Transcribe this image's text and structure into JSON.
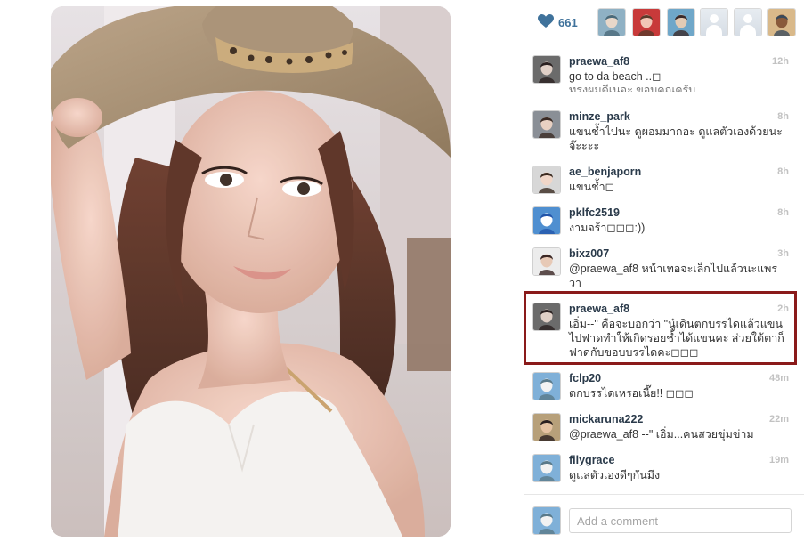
{
  "post": {
    "like_count": "661",
    "heart_icon": "heart-icon"
  },
  "likers": [
    {
      "name": "liker-avatar-1",
      "kind": "photo",
      "colors": [
        "#8fb1c4",
        "#e8d7c9",
        "#4a6a7a"
      ]
    },
    {
      "name": "liker-avatar-2",
      "kind": "photo",
      "colors": [
        "#c83a3a",
        "#f1c5b5",
        "#5a3a2a"
      ]
    },
    {
      "name": "liker-avatar-3",
      "kind": "photo",
      "colors": [
        "#6fa7c9",
        "#e3cbb5",
        "#3a2a2a"
      ]
    },
    {
      "name": "liker-avatar-4",
      "kind": "blank"
    },
    {
      "name": "liker-avatar-5",
      "kind": "blank"
    },
    {
      "name": "liker-avatar-6",
      "kind": "photo",
      "colors": [
        "#d9b98a",
        "#8a5a3a",
        "#3a4a5a"
      ]
    }
  ],
  "comments": [
    {
      "username": "praewa_af8",
      "time": "12h",
      "text": "go to da beach ..◻",
      "avatar_colors": [
        "#6b6b6b",
        "#e0cfc6",
        "#2a2020"
      ]
    },
    {
      "username": "minze_park",
      "time": "8h",
      "text": "แขนช้ำไปนะ ดูผอมมากอะ ดูแลตัวเองด้วยนะจ๊ะะะะ",
      "avatar_colors": [
        "#8a8f96",
        "#e8d0c2",
        "#3a2a24"
      ]
    },
    {
      "username": "ae_benjaporn",
      "time": "8h",
      "text": "แขนช้ำ◻",
      "avatar_colors": [
        "#d7d7d7",
        "#f0d6c8",
        "#3a2a20"
      ]
    },
    {
      "username": "pklfc2519",
      "time": "8h",
      "text": "งามจร้า◻◻◻:))",
      "avatar_colors": [
        "#4f8fd0",
        "#ffffff",
        "#2255aa"
      ]
    },
    {
      "username": "bixz007",
      "time": "3h",
      "text": "@praewa_af8 หน้าเทอจะเล็กไปแล้วนะแพรวา",
      "avatar_colors": [
        "#ececec",
        "#e7c9b6",
        "#3a2624"
      ]
    },
    {
      "username": "praewa_af8",
      "time": "2h",
      "text": "เอิ่ม--\" คือจะบอกว่า \"นู๋เดินตกบรรไดแล้วแขนไปฟาดทำให้เกิดรอยช้ำได้แขนคะ ส่วยใต้ตาก็ฟาดกับขอบบรรไดคะ◻◻◻",
      "avatar_colors": [
        "#6b6b6b",
        "#e0cfc6",
        "#2a2020"
      ]
    },
    {
      "username": "fclp20",
      "time": "48m",
      "text": "ตกบรรไดเหรอเนี๊ย!! ◻◻◻",
      "avatar_colors": [
        "#7fb0d8",
        "#f2f2f2",
        "#5a7a8a"
      ]
    },
    {
      "username": "mickaruna222",
      "time": "22m",
      "text": "@praewa_af8 --\" เอิ่ม...คนสวยขุ่มข่าม",
      "avatar_colors": [
        "#b7a07a",
        "#e5c3a3",
        "#2a2020"
      ]
    },
    {
      "username": "filygrace",
      "time": "19m",
      "text": "ดูแลตัวเองดีๆกันมึง",
      "avatar_colors": [
        "#7fb0d8",
        "#f2f2f2",
        "#5a7a8a"
      ]
    }
  ],
  "hidden_fragment": "ทรงผมดีเนอะ ขอบคุณครับ",
  "comment_box": {
    "placeholder": "Add a comment",
    "avatar_colors": [
      "#7fb0d8",
      "#f2f2f2",
      "#5a7a8a"
    ]
  },
  "colors": {
    "accent": "#3f729b",
    "highlight_border": "#8a1a1a",
    "time_text": "#c2c2c2"
  }
}
